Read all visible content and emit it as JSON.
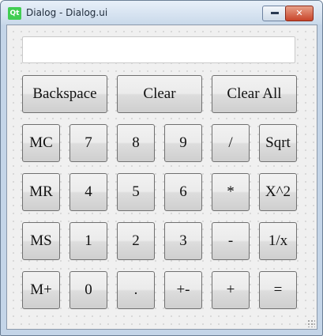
{
  "window": {
    "logo_text": "Qt",
    "title": "Dialog - Dialog.ui",
    "close_glyph": "✕"
  },
  "display": {
    "value": ""
  },
  "top_row": [
    "Backspace",
    "Clear",
    "Clear All"
  ],
  "grid": [
    [
      "MC",
      "7",
      "8",
      "9",
      "/",
      "Sqrt"
    ],
    [
      "MR",
      "4",
      "5",
      "6",
      "*",
      "X^2"
    ],
    [
      "MS",
      "1",
      "2",
      "3",
      "-",
      "1/x"
    ],
    [
      "M+",
      "0",
      ".",
      "+-",
      "+",
      "="
    ]
  ]
}
